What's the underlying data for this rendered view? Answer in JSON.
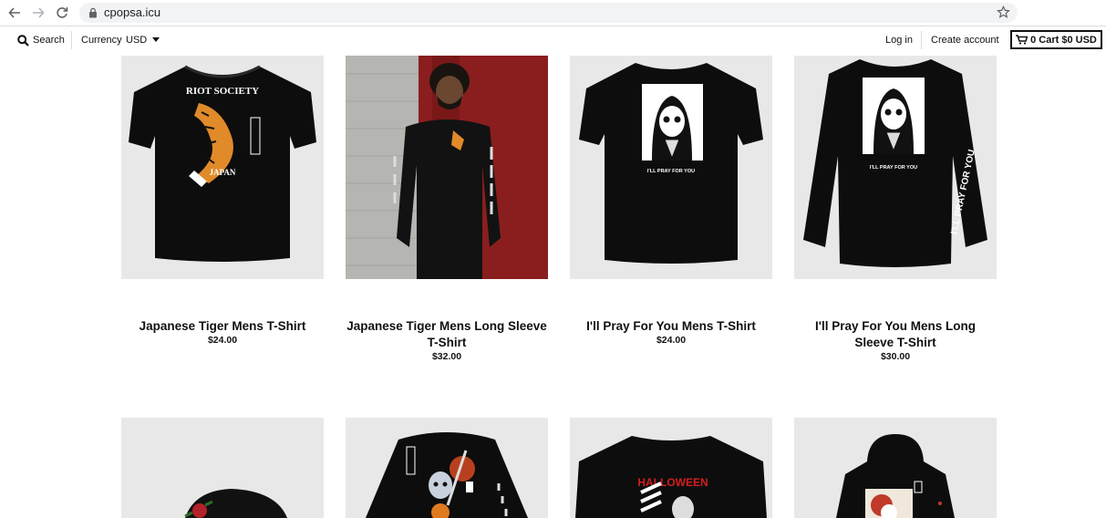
{
  "browser": {
    "url": "cpopsa.icu"
  },
  "header": {
    "search_label": "Search",
    "currency_label": "Currency",
    "currency_value": "USD",
    "login_label": "Log in",
    "create_account_label": "Create account",
    "cart_label": "0 Cart $0 USD"
  },
  "products": [
    {
      "title": "Japanese Tiger Mens T-Shirt",
      "price": "$24.00"
    },
    {
      "title": "Japanese Tiger Mens Long Sleeve T-Shirt",
      "price": "$32.00"
    },
    {
      "title": "I'll Pray For You Mens T-Shirt",
      "price": "$24.00"
    },
    {
      "title": "I'll Pray For You Mens Long Sleeve T-Shirt",
      "price": "$30.00"
    }
  ],
  "shirt_prints": {
    "tiger_top": "RIOT SOCIETY",
    "tiger_bottom": "JAPAN",
    "pray_caption": "I'LL PRAY FOR YOU",
    "sleeve_text": "I'LL PRAY FOR YOU",
    "halloween": "HALLOWEEN"
  },
  "colors": {
    "chip_bg": "#f1f3f4",
    "image_bg": "#e8e8e8",
    "shirt": "#0d0d0d",
    "brick": "#8a1e1e",
    "tiger": "#e08a2a",
    "halloween_red": "#d11f1f"
  }
}
